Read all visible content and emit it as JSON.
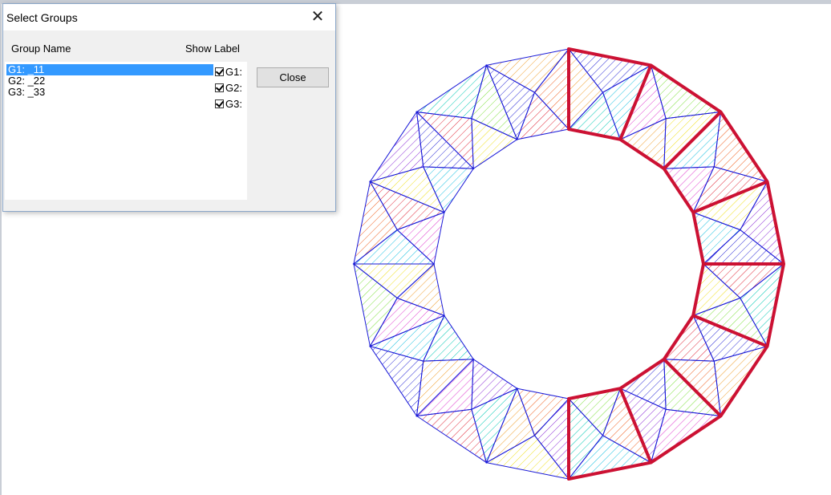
{
  "dialog": {
    "title": "Select Groups",
    "col_group_name": "Group Name",
    "col_show_label": "Show Label",
    "close_label": "Close",
    "groups": [
      {
        "name": "G1: _11",
        "label": "G1:",
        "checked": true,
        "selected": true
      },
      {
        "name": "G2: _22",
        "label": "G2:",
        "checked": true,
        "selected": false
      },
      {
        "name": "G3: _33",
        "label": "G3:",
        "checked": true,
        "selected": false
      }
    ]
  },
  "viewport": {
    "mesh_colors": {
      "edge": "#1a1ad8",
      "highlight": "#cc1133",
      "fills": [
        "#2b2bd6",
        "#18c0e0",
        "#00c8b4",
        "#80e040",
        "#f0e020",
        "#f0a030",
        "#f06020",
        "#e02a3a",
        "#e040d0",
        "#8a2ad6"
      ]
    }
  }
}
